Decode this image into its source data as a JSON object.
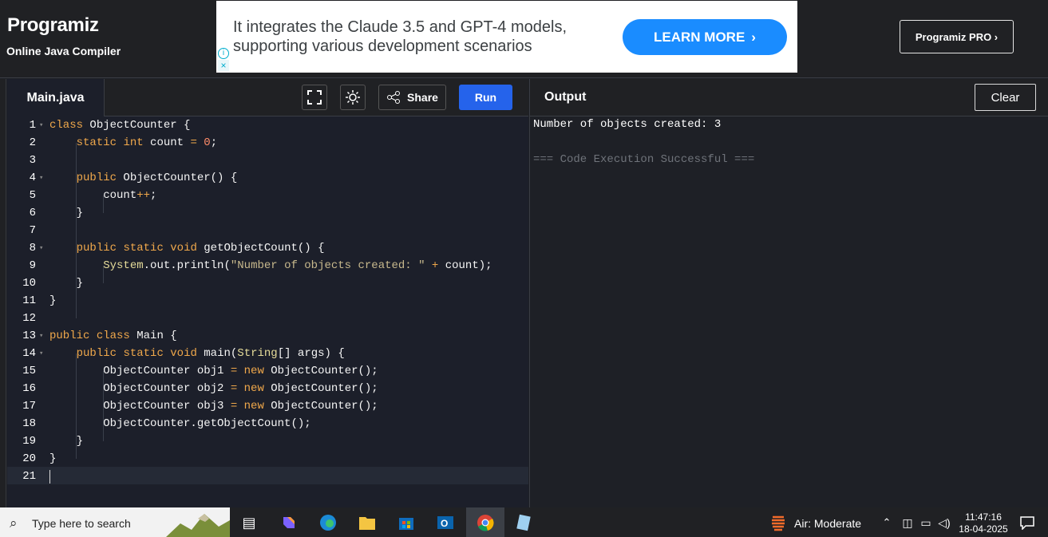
{
  "header": {
    "logo_text": "Programiz",
    "subtitle": "Online Java Compiler",
    "ad": {
      "text": "It integrates the Claude 3.5 and GPT-4 models, supporting various development scenarios",
      "button": "LEARN MORE"
    },
    "pro_button": "Programiz PRO ›"
  },
  "editor": {
    "tab_label": "Main.java",
    "share_label": "Share",
    "run_label": "Run",
    "lines": [
      "1",
      "2",
      "3",
      "4",
      "5",
      "6",
      "7",
      "8",
      "9",
      "10",
      "11",
      "12",
      "13",
      "14",
      "15",
      "16",
      "17",
      "18",
      "19",
      "20",
      "21"
    ]
  },
  "output": {
    "title": "Output",
    "clear_label": "Clear",
    "result": "Number of objects created: 3",
    "status": "=== Code Execution Successful ==="
  },
  "taskbar": {
    "search_placeholder": "Type here to search",
    "air_quality": "Air: Moderate",
    "time": "11:47:16",
    "date": "18-04-2025"
  },
  "colors": {
    "accent": "#2563eb",
    "keyword": "#f0a84b",
    "number": "#ff8c69",
    "string": "#c8b98d"
  }
}
